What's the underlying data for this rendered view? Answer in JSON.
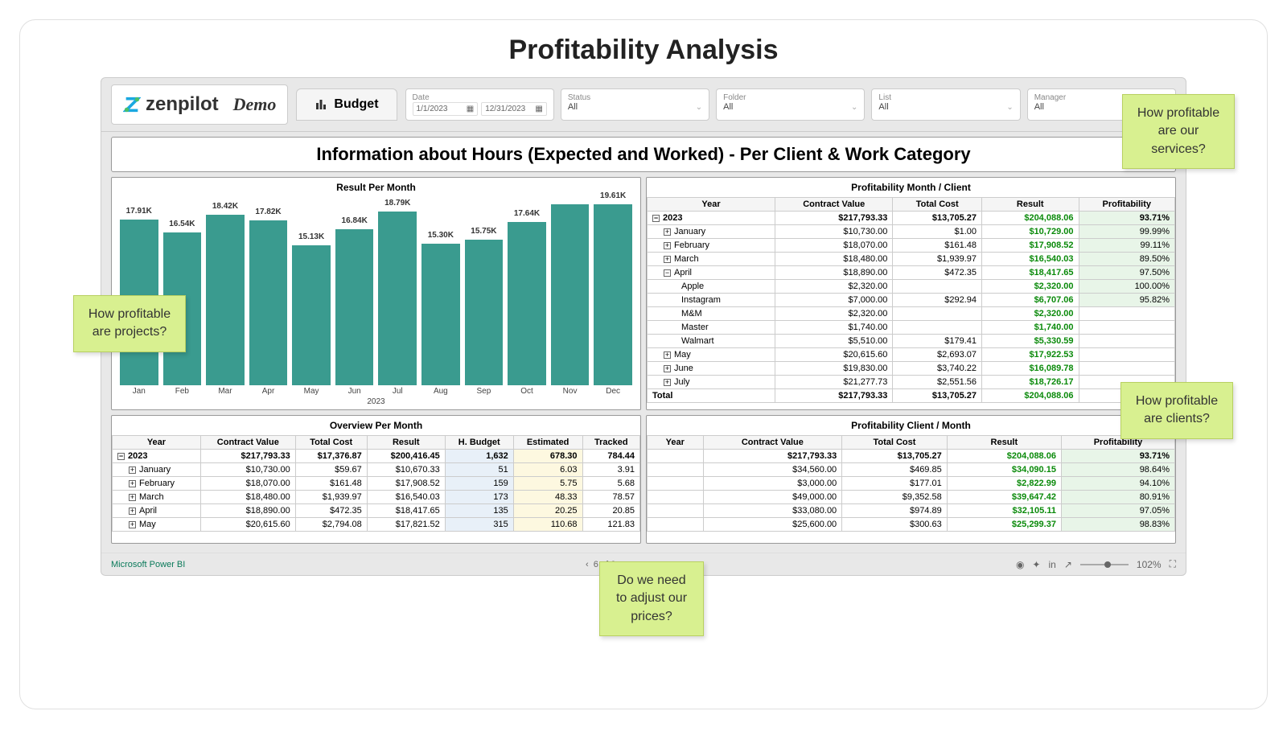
{
  "page_title": "Profitability Analysis",
  "brand": "zenpilot",
  "demo_label": "Demo",
  "tab_label": "Budget",
  "filters": {
    "date": {
      "label": "Date",
      "start": "1/1/2023",
      "end": "12/31/2023"
    },
    "status": {
      "label": "Status",
      "value": "All"
    },
    "folder": {
      "label": "Folder",
      "value": "All"
    },
    "list": {
      "label": "List",
      "value": "All"
    },
    "manager": {
      "label": "Manager",
      "value": "All"
    }
  },
  "section_title": "Information about Hours (Expected and Worked) - Per Client & Work Category",
  "chart_title": "Result Per Month",
  "chart_data": {
    "type": "bar",
    "title": "Result Per Month",
    "xlabel": "2023",
    "ylabel": "",
    "ylim": [
      0,
      20
    ],
    "categories": [
      "Jan",
      "Feb",
      "Mar",
      "Apr",
      "May",
      "Jun",
      "Jul",
      "Aug",
      "Sep",
      "Oct",
      "Nov",
      "Dec"
    ],
    "values": [
      17.91,
      16.54,
      18.42,
      17.82,
      15.13,
      16.84,
      18.79,
      15.3,
      15.75,
      17.64,
      19.61,
      19.61
    ],
    "labels": [
      "17.91K",
      "16.54K",
      "18.42K",
      "17.82K",
      "15.13K",
      "16.84K",
      "18.79K",
      "15.30K",
      "15.75K",
      "17.64K",
      "",
      "19.61K"
    ]
  },
  "table_month_client": {
    "title": "Profitability Month / Client",
    "headers": [
      "Year",
      "Contract Value",
      "Total Cost",
      "Result",
      "Profitability"
    ],
    "rows": [
      {
        "level": 0,
        "exp": "-",
        "cells": [
          "2023",
          "$217,793.33",
          "$13,705.27",
          "$204,088.06",
          "93.71%"
        ],
        "bold": true,
        "green": [
          3
        ]
      },
      {
        "level": 1,
        "exp": "+",
        "cells": [
          "January",
          "$10,730.00",
          "$1.00",
          "$10,729.00",
          "99.99%"
        ],
        "green": [
          3
        ]
      },
      {
        "level": 1,
        "exp": "+",
        "cells": [
          "February",
          "$18,070.00",
          "$161.48",
          "$17,908.52",
          "99.11%"
        ],
        "green": [
          3
        ]
      },
      {
        "level": 1,
        "exp": "+",
        "cells": [
          "March",
          "$18,480.00",
          "$1,939.97",
          "$16,540.03",
          "89.50%"
        ],
        "green": [
          3
        ]
      },
      {
        "level": 1,
        "exp": "-",
        "cells": [
          "April",
          "$18,890.00",
          "$472.35",
          "$18,417.65",
          "97.50%"
        ],
        "green": [
          3
        ]
      },
      {
        "level": 2,
        "cells": [
          "Apple",
          "$2,320.00",
          "",
          "$2,320.00",
          "100.00%"
        ],
        "green": [
          3
        ]
      },
      {
        "level": 2,
        "cells": [
          "Instagram",
          "$7,000.00",
          "$292.94",
          "$6,707.06",
          "95.82%"
        ],
        "green": [
          3
        ]
      },
      {
        "level": 2,
        "cells": [
          "M&M",
          "$2,320.00",
          "",
          "$2,320.00",
          ""
        ],
        "green": [
          3
        ]
      },
      {
        "level": 2,
        "cells": [
          "Master",
          "$1,740.00",
          "",
          "$1,740.00",
          ""
        ],
        "green": [
          3
        ]
      },
      {
        "level": 2,
        "cells": [
          "Walmart",
          "$5,510.00",
          "$179.41",
          "$5,330.59",
          ""
        ],
        "green": [
          3
        ]
      },
      {
        "level": 1,
        "exp": "+",
        "cells": [
          "May",
          "$20,615.60",
          "$2,693.07",
          "$17,922.53",
          ""
        ],
        "green": [
          3
        ]
      },
      {
        "level": 1,
        "exp": "+",
        "cells": [
          "June",
          "$19,830.00",
          "$3,740.22",
          "$16,089.78",
          ""
        ],
        "green": [
          3
        ]
      },
      {
        "level": 1,
        "exp": "+",
        "cells": [
          "July",
          "$21,277.73",
          "$2,551.56",
          "$18,726.17",
          ""
        ],
        "green": [
          3
        ]
      },
      {
        "level": 0,
        "cells": [
          "Total",
          "$217,793.33",
          "$13,705.27",
          "$204,088.06",
          ""
        ],
        "bold": true,
        "green": [
          3
        ]
      }
    ]
  },
  "table_overview": {
    "title": "Overview Per Month",
    "headers": [
      "Year",
      "Contract Value",
      "Total Cost",
      "Result",
      "H. Budget",
      "Estimated",
      "Tracked"
    ],
    "rows": [
      {
        "level": 0,
        "exp": "-",
        "cells": [
          "2023",
          "$217,793.33",
          "$17,376.87",
          "$200,416.45",
          "1,632",
          "678.30",
          "784.44"
        ],
        "bold": true
      },
      {
        "level": 1,
        "exp": "+",
        "cells": [
          "January",
          "$10,730.00",
          "$59.67",
          "$10,670.33",
          "51",
          "6.03",
          "3.91"
        ]
      },
      {
        "level": 1,
        "exp": "+",
        "cells": [
          "February",
          "$18,070.00",
          "$161.48",
          "$17,908.52",
          "159",
          "5.75",
          "5.68"
        ]
      },
      {
        "level": 1,
        "exp": "+",
        "cells": [
          "March",
          "$18,480.00",
          "$1,939.97",
          "$16,540.03",
          "173",
          "48.33",
          "78.57"
        ]
      },
      {
        "level": 1,
        "exp": "+",
        "cells": [
          "April",
          "$18,890.00",
          "$472.35",
          "$18,417.65",
          "135",
          "20.25",
          "20.85"
        ]
      },
      {
        "level": 1,
        "exp": "+",
        "cells": [
          "May",
          "$20,615.60",
          "$2,794.08",
          "$17,821.52",
          "315",
          "110.68",
          "121.83"
        ]
      }
    ]
  },
  "table_client_month": {
    "title": "Profitability Client / Month",
    "headers": [
      "Year",
      "Contract Value",
      "Total Cost",
      "Result",
      "Profitability"
    ],
    "rows": [
      {
        "cells": [
          "",
          "$217,793.33",
          "$13,705.27",
          "$204,088.06",
          "93.71%"
        ],
        "bold": true,
        "green": [
          3
        ]
      },
      {
        "cells": [
          "",
          "$34,560.00",
          "$469.85",
          "$34,090.15",
          "98.64%"
        ],
        "green": [
          3
        ]
      },
      {
        "cells": [
          "",
          "$3,000.00",
          "$177.01",
          "$2,822.99",
          "94.10%"
        ],
        "green": [
          3
        ]
      },
      {
        "cells": [
          "",
          "$49,000.00",
          "$9,352.58",
          "$39,647.42",
          "80.91%"
        ],
        "green": [
          3
        ]
      },
      {
        "cells": [
          "",
          "$33,080.00",
          "$974.89",
          "$32,105.11",
          "97.05%"
        ],
        "green": [
          3
        ]
      },
      {
        "cells": [
          "",
          "$25,600.00",
          "$300.63",
          "$25,299.37",
          "98.83%"
        ],
        "green": [
          3
        ]
      }
    ]
  },
  "footer": {
    "brand": "Microsoft Power BI",
    "pager": "6 of 6",
    "zoom": "102%"
  },
  "stickies": {
    "s1": "How profitable are our services?",
    "s2": "How profitable are projects?",
    "s3": "How profitable are clients?",
    "s4": "Do we need to adjust our prices?"
  }
}
